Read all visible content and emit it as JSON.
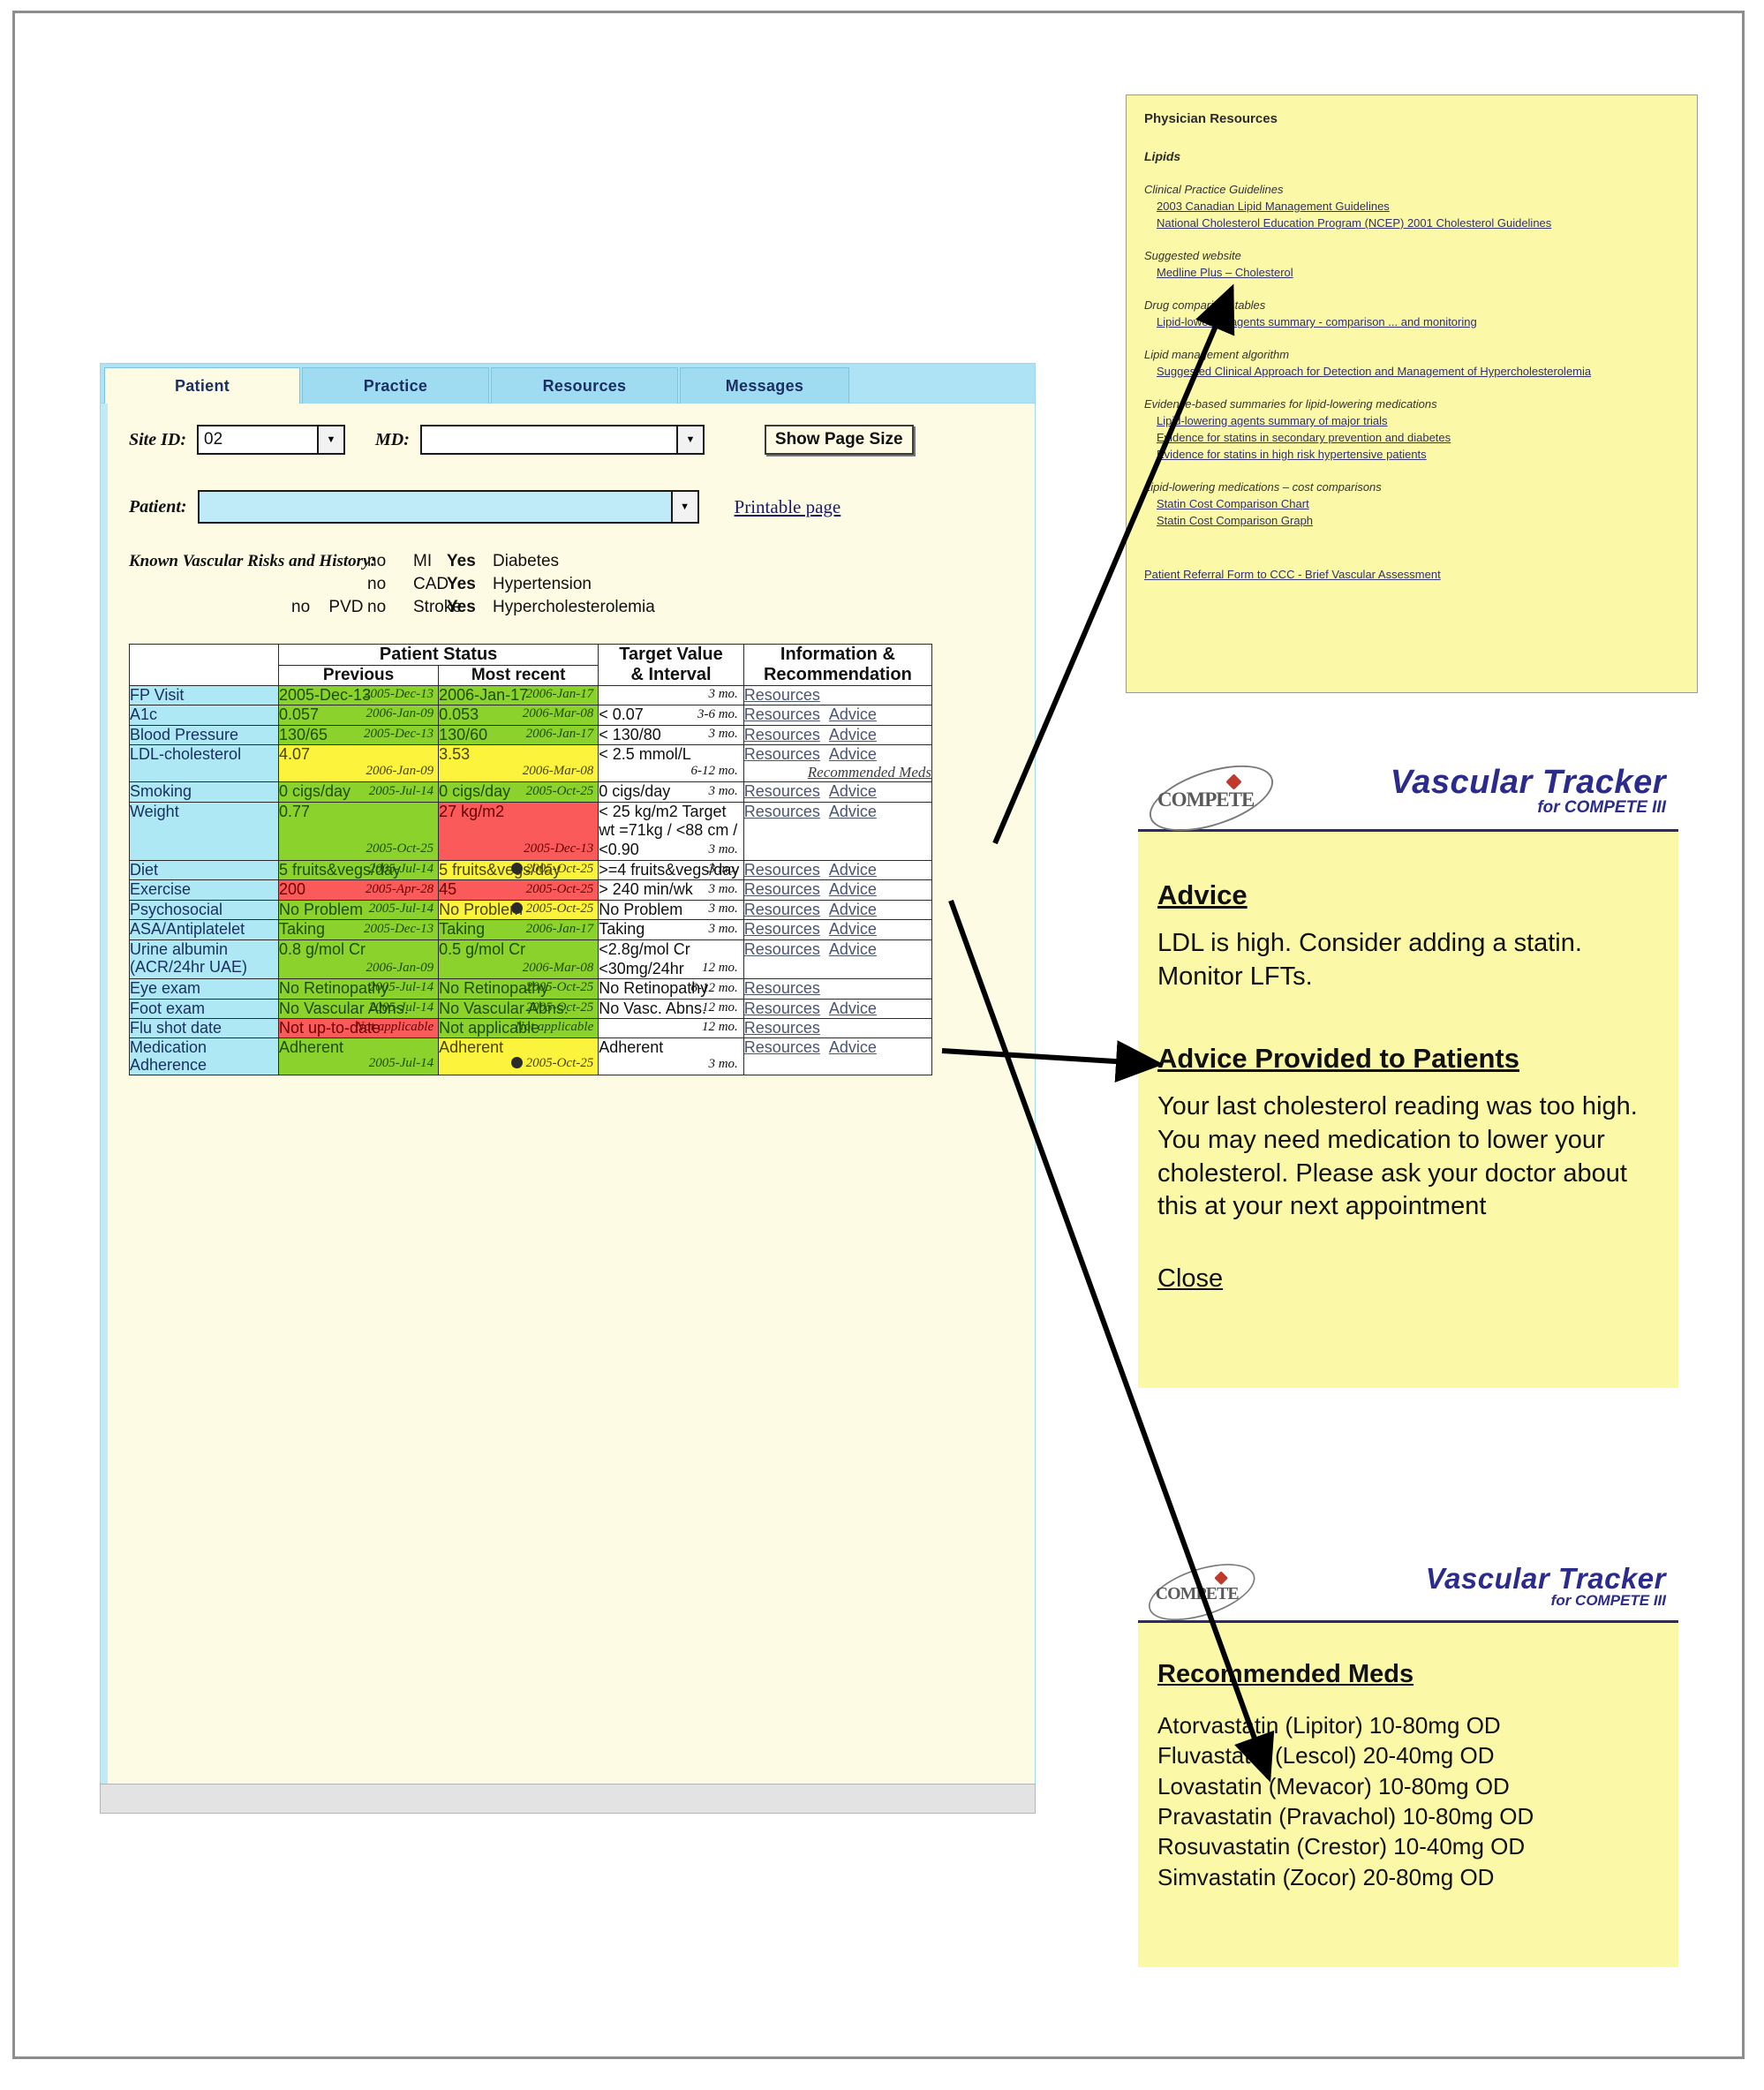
{
  "tabs": [
    {
      "label": "Patient",
      "active": true
    },
    {
      "label": "Practice",
      "active": false
    },
    {
      "label": "Resources",
      "active": false
    },
    {
      "label": "Messages",
      "active": false
    }
  ],
  "form": {
    "site_label": "Site ID:",
    "site_value": "02",
    "md_label": "MD:",
    "md_value": "",
    "show_page_size": "Show Page Size",
    "patient_label": "Patient:",
    "patient_value": "",
    "printable": "Printable page"
  },
  "risks": {
    "title": "Known Vascular Risks and History:",
    "items": [
      {
        "c1v": "",
        "c1k": "",
        "c2v": "no",
        "c2k": "MI",
        "c3v": "Yes",
        "c3k": "Diabetes"
      },
      {
        "c1v": "",
        "c1k": "",
        "c2v": "no",
        "c2k": "CAD",
        "c3v": "Yes",
        "c3k": "Hypertension"
      },
      {
        "c1v": "no",
        "c1k": "PVD",
        "c2v": "no",
        "c2k": "Stroke",
        "c3v": "Yes",
        "c3k": "Hypercholesterolemia"
      }
    ]
  },
  "table": {
    "headers": {
      "status": "Patient Status",
      "previous": "Previous",
      "recent": "Most recent",
      "target": "Target Value & Interval",
      "target_l1": "Target Value",
      "target_l2": "& Interval",
      "info": "Information & Recommendation",
      "info_l1": "Information &",
      "info_l2": "Recommendation"
    },
    "rows": [
      {
        "label": "FP Visit",
        "prev": {
          "value": "2005-Dec-13",
          "date": "2005-Dec-13",
          "color": "g",
          "smiley": false
        },
        "recent": {
          "value": "2006-Jan-17",
          "date": "2006-Jan-17",
          "color": "g",
          "smiley": false
        },
        "target": "",
        "interval": "3 mo.",
        "links": [
          "Resources"
        ],
        "rec_meds": ""
      },
      {
        "label": "A1c",
        "prev": {
          "value": "0.057",
          "date": "2006-Jan-09",
          "color": "g",
          "smiley": false
        },
        "recent": {
          "value": "0.053",
          "date": "2006-Mar-08",
          "color": "g",
          "smiley": false
        },
        "target": "< 0.07",
        "interval": "3-6 mo.",
        "links": [
          "Resources",
          "Advice"
        ],
        "rec_meds": ""
      },
      {
        "label": "Blood Pressure",
        "prev": {
          "value": "130/65",
          "date": "2005-Dec-13",
          "color": "g",
          "smiley": false
        },
        "recent": {
          "value": "130/60",
          "date": "2006-Jan-17",
          "color": "g",
          "smiley": false
        },
        "target": "< 130/80",
        "interval": "3 mo.",
        "links": [
          "Resources",
          "Advice"
        ],
        "rec_meds": ""
      },
      {
        "label": "LDL-cholesterol",
        "prev": {
          "value": "4.07",
          "date": "2006-Jan-09",
          "color": "y",
          "smiley": false
        },
        "recent": {
          "value": "3.53",
          "date": "2006-Mar-08",
          "color": "y",
          "smiley": false
        },
        "target": "< 2.5 mmol/L",
        "interval": "6-12 mo.",
        "links": [
          "Resources",
          "Advice"
        ],
        "rec_meds": "Recommended Meds"
      },
      {
        "label": "Smoking",
        "prev": {
          "value": "0 cigs/day",
          "date": "2005-Jul-14",
          "color": "g",
          "smiley": false
        },
        "recent": {
          "value": "0 cigs/day",
          "date": "2005-Oct-25",
          "color": "g",
          "smiley": false
        },
        "target": "0 cigs/day",
        "interval": "3 mo.",
        "links": [
          "Resources",
          "Advice"
        ],
        "rec_meds": ""
      },
      {
        "label": "Weight",
        "prev": {
          "value": "0.77",
          "date": "2005-Oct-25",
          "color": "g",
          "smiley": false
        },
        "recent": {
          "value": "27 kg/m2",
          "date": "2005-Dec-13",
          "color": "r",
          "smiley": false
        },
        "target": "< 25 kg/m2 Target wt =71kg / <88 cm / <0.90",
        "interval": "3 mo.",
        "links": [
          "Resources",
          "Advice"
        ],
        "rec_meds": ""
      },
      {
        "label": "Diet",
        "prev": {
          "value": "5 fruits&vegs/day",
          "date": "2005-Jul-14",
          "color": "g",
          "smiley": false
        },
        "recent": {
          "value": "5 fruits&vegs/day",
          "date": "2005-Oct-25",
          "color": "y",
          "smiley": true
        },
        "target": ">=4 fruits&vegs/day",
        "interval": "3 mo.",
        "links": [
          "Resources",
          "Advice"
        ],
        "rec_meds": ""
      },
      {
        "label": "Exercise",
        "prev": {
          "value": "200",
          "date": "2005-Apr-28",
          "color": "r",
          "smiley": false
        },
        "recent": {
          "value": "45",
          "date": "2005-Oct-25",
          "color": "r",
          "smiley": false
        },
        "target": "> 240 min/wk",
        "interval": "3 mo.",
        "links": [
          "Resources",
          "Advice"
        ],
        "rec_meds": ""
      },
      {
        "label": "Psychosocial",
        "prev": {
          "value": "No Problem",
          "date": "2005-Jul-14",
          "color": "g",
          "smiley": false
        },
        "recent": {
          "value": "No Problem",
          "date": "2005-Oct-25",
          "color": "y",
          "smiley": true
        },
        "target": "No Problem",
        "interval": "3 mo.",
        "links": [
          "Resources",
          "Advice"
        ],
        "rec_meds": ""
      },
      {
        "label": "ASA/Antiplatelet",
        "prev": {
          "value": "Taking",
          "date": "2005-Dec-13",
          "color": "g",
          "smiley": false
        },
        "recent": {
          "value": "Taking",
          "date": "2006-Jan-17",
          "color": "g",
          "smiley": false
        },
        "target": "Taking",
        "interval": "3 mo.",
        "links": [
          "Resources",
          "Advice"
        ],
        "rec_meds": ""
      },
      {
        "label": "Urine albumin (ACR/24hr UAE)",
        "prev": {
          "value": "0.8 g/mol Cr",
          "date": "2006-Jan-09",
          "color": "g",
          "smiley": false
        },
        "recent": {
          "value": "0.5 g/mol Cr",
          "date": "2006-Mar-08",
          "color": "g",
          "smiley": false
        },
        "target": "<2.8g/mol Cr <30mg/24hr",
        "interval": "12 mo.",
        "links": [
          "Resources",
          "Advice"
        ],
        "rec_meds": ""
      },
      {
        "label": "Eye exam",
        "prev": {
          "value": "No Retinopathy",
          "date": "2005-Jul-14",
          "color": "g",
          "smiley": false
        },
        "recent": {
          "value": "No Retinopathy",
          "date": "2005-Oct-25",
          "color": "g",
          "smiley": false
        },
        "target": "No Retinopathy",
        "interval": "6-12 mo.",
        "links": [
          "Resources"
        ],
        "rec_meds": ""
      },
      {
        "label": "Foot exam",
        "prev": {
          "value": "No Vascular Abns.",
          "date": "2005-Jul-14",
          "color": "g",
          "smiley": false
        },
        "recent": {
          "value": "No Vascular Abns.",
          "date": "2005-Oct-25",
          "color": "g",
          "smiley": false
        },
        "target": "No Vasc. Abns.",
        "interval": "12 mo.",
        "links": [
          "Resources",
          "Advice"
        ],
        "rec_meds": ""
      },
      {
        "label": "Flu shot date",
        "prev": {
          "value": "Not up-to-date",
          "date": "Not applicable",
          "color": "r",
          "smiley": false
        },
        "recent": {
          "value": "Not applicable",
          "date": "Not applicable",
          "color": "g",
          "smiley": false
        },
        "target": "",
        "interval": "12 mo.",
        "links": [
          "Resources"
        ],
        "rec_meds": ""
      },
      {
        "label": "Medication Adherence",
        "prev": {
          "value": "Adherent",
          "date": "2005-Jul-14",
          "color": "g",
          "smiley": false
        },
        "recent": {
          "value": "Adherent",
          "date": "2005-Oct-25",
          "color": "y",
          "smiley": true
        },
        "target": "Adherent",
        "interval": "3 mo.",
        "links": [
          "Resources",
          "Advice"
        ],
        "rec_meds": ""
      }
    ]
  },
  "resources_panel": {
    "title": "Physician Resources",
    "section": "Lipids",
    "groups": [
      {
        "heading": "Clinical Practice Guidelines",
        "links": [
          "2003 Canadian Lipid Management Guidelines",
          "National Cholesterol Education Program (NCEP) 2001 Cholesterol Guidelines"
        ]
      },
      {
        "heading": "Suggested website",
        "links": [
          "Medline Plus – Cholesterol"
        ]
      },
      {
        "heading": "Drug comparison tables",
        "links": [
          "Lipid-lowering agents summary - comparison ... and monitoring"
        ]
      },
      {
        "heading": "Lipid management algorithm",
        "links": [
          "Suggested Clinical Approach for Detection and Management of Hypercholesterolemia"
        ]
      },
      {
        "heading": "Evidence-based summaries for lipid-lowering medications",
        "links": [
          "Lipid-lowering agents summary of major trials",
          "Evidence for statins in secondary prevention and diabetes",
          "Evidence for statins in high risk hypertensive patients"
        ]
      },
      {
        "heading": "Lipid-lowering medications – cost comparisons",
        "links": [
          "Statin Cost Comparison Chart",
          "Statin Cost Comparison Graph"
        ]
      }
    ],
    "footer_link": "Patient Referral Form to CCC - Brief Vascular Assessment"
  },
  "brand": {
    "logo_word": "COMPETE",
    "title": "Vascular Tracker",
    "subtitle": "for COMPETE III"
  },
  "advice_panel": {
    "heading": "Advice",
    "body": "LDL is high. Consider adding a statin. Monitor LFTs.",
    "patient_heading": "Advice Provided to Patients",
    "patient_body": "Your last cholesterol reading was too high. You may need medication to lower your cholesterol. Please ask your doctor about this at your next appointment",
    "close": "Close"
  },
  "meds_panel": {
    "heading": "Recommended Meds",
    "meds": [
      "Atorvastatin (Lipitor) 10-80mg OD",
      "Fluvastatin (Lescol) 20-40mg OD",
      "Lovastatin (Mevacor) 10-80mg OD",
      "Pravastatin (Pravachol) 10-80mg OD",
      "Rosuvastatin (Crestor) 10-40mg OD",
      "Simvastatin (Zocor) 20-80mg OD"
    ]
  },
  "colors": {
    "good": "#8cd22d",
    "warn": "#fbf33c",
    "bad": "#fa5a5a",
    "rowlabel": "#aee8f5",
    "panel_yellow": "#fbf8a8",
    "brand_blue": "#2b2b8c"
  }
}
